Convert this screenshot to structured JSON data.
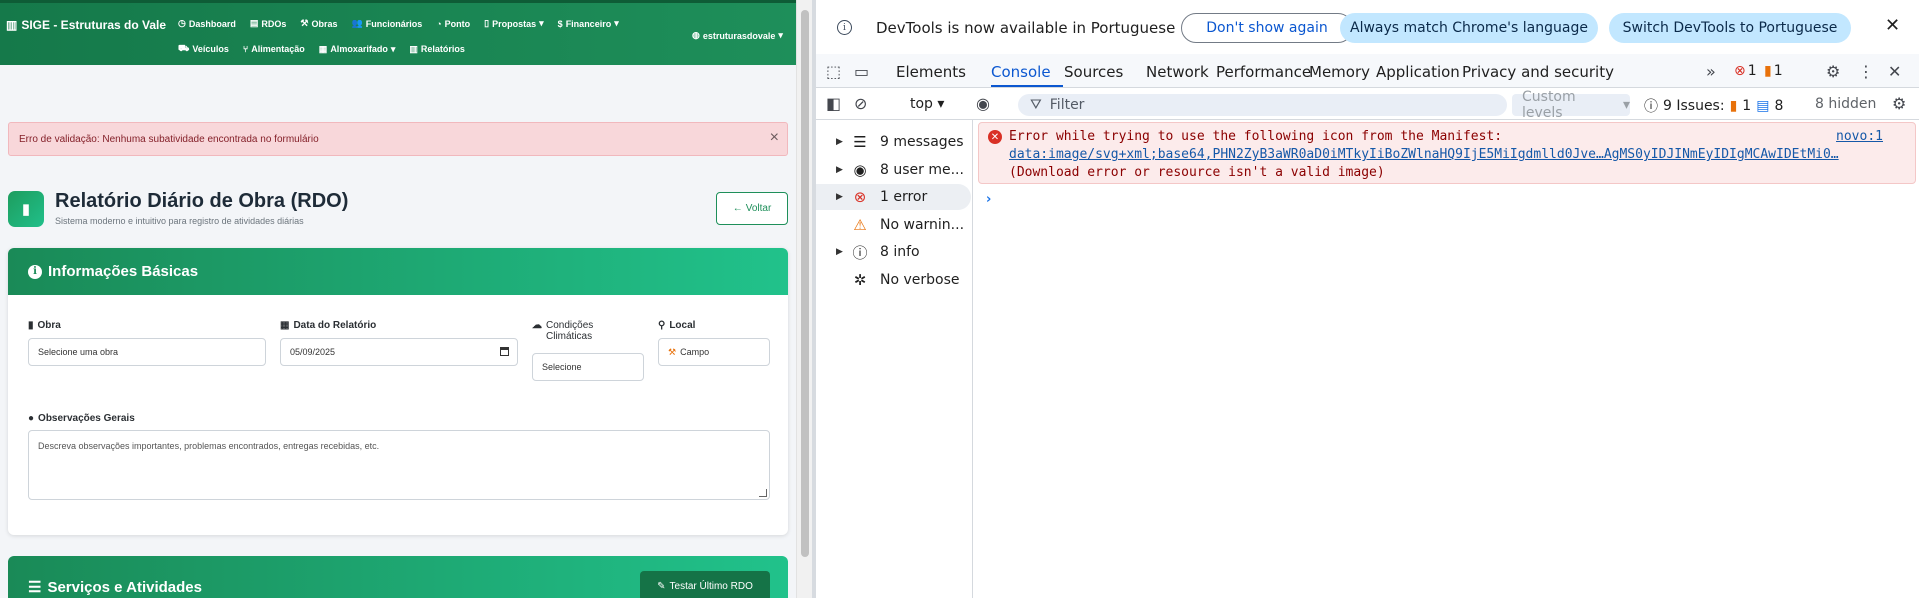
{
  "app": {
    "brand": "SIGE - Estruturas do Vale",
    "nav_row1": [
      {
        "label": "Dashboard",
        "icon": "speedometer-icon",
        "glyph": "◷"
      },
      {
        "label": "RDOs",
        "icon": "clipboard-icon",
        "glyph": "▤"
      },
      {
        "label": "Obras",
        "icon": "hammer-icon",
        "glyph": "⚒"
      },
      {
        "label": "Funcionários",
        "icon": "users-icon",
        "glyph": "👥"
      },
      {
        "label": "Ponto",
        "icon": "clock-icon",
        "glyph": "◔"
      },
      {
        "label": "Propostas",
        "icon": "document-icon",
        "glyph": "▯",
        "dropdown": true
      },
      {
        "label": "Financeiro",
        "icon": "dollar-icon",
        "glyph": "$",
        "dropdown": true
      }
    ],
    "nav_row2": [
      {
        "label": "Veículos",
        "icon": "car-icon",
        "glyph": "⛟"
      },
      {
        "label": "Alimentação",
        "icon": "utensils-icon",
        "glyph": "⑂"
      },
      {
        "label": "Almoxarifado",
        "icon": "warehouse-icon",
        "glyph": "▦",
        "dropdown": true
      },
      {
        "label": "Relatórios",
        "icon": "chart-icon",
        "glyph": "▥"
      }
    ],
    "user": "estruturasdovale",
    "alert": "Erro de validação: Nenhuma subatividade encontrada no formulário",
    "page_title": "Relatório Diário de Obra (RDO)",
    "page_subtitle": "Sistema moderno e intuitivo para registro de atividades diárias",
    "back_label": "Voltar",
    "card_title": "Informações Básicas",
    "fields": {
      "obra_label": "Obra",
      "obra_value": "Selecione uma obra",
      "data_label": "Data do Relatório",
      "data_value": "05/09/2025",
      "clima_label": "Condições Climáticas",
      "clima_value": "Selecione",
      "local_label": "Local",
      "local_value": "Campo",
      "obs_label": "Observações Gerais",
      "obs_placeholder": "Descreva observações importantes, problemas encontrados, entregas recebidas, etc."
    },
    "card2_title": "Serviços e Atividades",
    "test_label": "Testar Último RDO"
  },
  "devtools": {
    "info_text": "DevTools is now available in Portuguese",
    "btn_dont_show": "Don't show again",
    "btn_match": "Always match Chrome's language",
    "btn_switch": "Switch DevTools to Portuguese",
    "tabs": [
      "Elements",
      "Console",
      "Sources",
      "Network",
      "Performance",
      "Memory",
      "Application",
      "Privacy and security"
    ],
    "active_tab": "Console",
    "tab_error_count": "1",
    "tab_warn_count": "1",
    "context": "top",
    "filter_placeholder": "Filter",
    "levels": "Custom levels",
    "issues_label": "9 Issues:",
    "issues_orange": "1",
    "issues_blue": "8",
    "hidden": "8 hidden",
    "sidebar": [
      {
        "label": "9 messages",
        "icon": "list-icon",
        "glyph": "☰",
        "expandable": true
      },
      {
        "label": "8 user me...",
        "icon": "user-circle-icon",
        "glyph": "◉",
        "expandable": true
      },
      {
        "label": "1 error",
        "icon": "error-icon",
        "glyph": "⊗",
        "expandable": true,
        "selected": true
      },
      {
        "label": "No warnin...",
        "icon": "warning-icon",
        "glyph": "⚠",
        "expandable": false
      },
      {
        "label": "8 info",
        "icon": "info-icon",
        "glyph": "ⓘ",
        "expandable": true
      },
      {
        "label": "No verbose",
        "icon": "bug-icon",
        "glyph": "✲",
        "expandable": false
      }
    ],
    "error": {
      "line1": "Error while trying to use the following icon from the Manifest:",
      "line2": "data:image/svg+xml;base64,PHN2ZyB3aWR0aD0iMTkyIiBoZWlnaHQ9IjE5MiIgdmlld0Jve…AgMS0yIDJINmEyIDIgMCAwIDEtMi0…",
      "line3": "(Download error or resource isn't a valid image)",
      "source": "novo:1"
    },
    "colors": {
      "accent": "#0b57d0",
      "error": "#d93025"
    }
  }
}
